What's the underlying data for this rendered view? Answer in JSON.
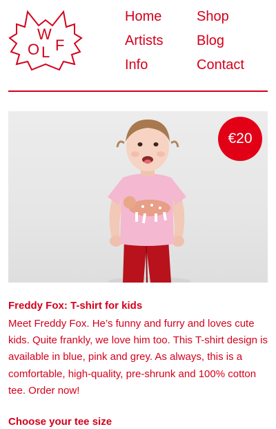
{
  "logo": {
    "letters": [
      "O",
      "W",
      "L",
      "F"
    ],
    "brand_color": "#d3001b"
  },
  "nav": {
    "home": "Home",
    "artists": "Artists",
    "info": "Info",
    "shop": "Shop",
    "blog": "Blog",
    "contact": "Contact"
  },
  "product": {
    "price": "€20",
    "title": "Freddy Fox: T-shirt for kids",
    "description": "Meet Freddy Fox. He’s funny and furry and loves cute kids. Quite frankly, we love him too. This T-shirt design is available in blue, pink and grey. As always, this is a comfortable, high-quality, pre-shrunk and 100% cotton tee. Order now!",
    "choose_size_label": "Choose your tee size"
  },
  "colors": {
    "accent": "#d3001b",
    "price_badge": "#e10016",
    "background": "#ffffff"
  }
}
